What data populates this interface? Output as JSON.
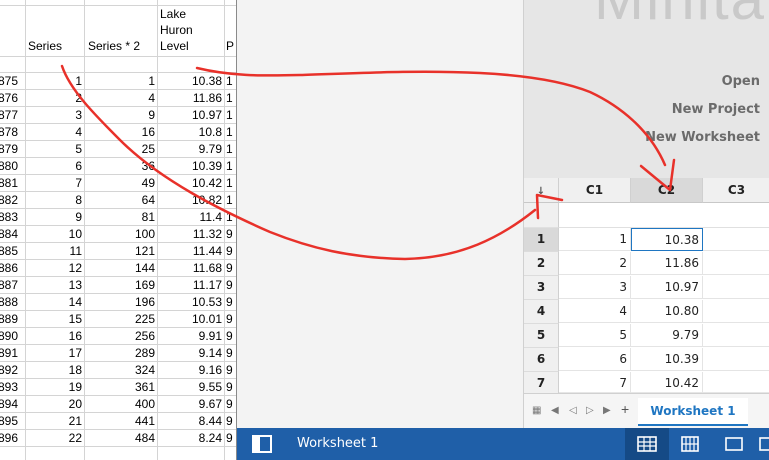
{
  "excel": {
    "headers": {
      "series": "Series",
      "series_sq": "Series * 2",
      "lake_line1": "Lake",
      "lake_line2": "Huron",
      "lake_line3": "Level",
      "partial": "P"
    },
    "rows": [
      {
        "year": "875",
        "s": "1",
        "sq": "1",
        "lv": "10.38",
        "p": "1"
      },
      {
        "year": "876",
        "s": "2",
        "sq": "4",
        "lv": "11.86",
        "p": "1"
      },
      {
        "year": "877",
        "s": "3",
        "sq": "9",
        "lv": "10.97",
        "p": "1"
      },
      {
        "year": "878",
        "s": "4",
        "sq": "16",
        "lv": "10.8",
        "p": "1"
      },
      {
        "year": "879",
        "s": "5",
        "sq": "25",
        "lv": "9.79",
        "p": "1"
      },
      {
        "year": "880",
        "s": "6",
        "sq": "36",
        "lv": "10.39",
        "p": "1"
      },
      {
        "year": "881",
        "s": "7",
        "sq": "49",
        "lv": "10.42",
        "p": "1"
      },
      {
        "year": "882",
        "s": "8",
        "sq": "64",
        "lv": "10.82",
        "p": "1"
      },
      {
        "year": "883",
        "s": "9",
        "sq": "81",
        "lv": "11.4",
        "p": "1"
      },
      {
        "year": "884",
        "s": "10",
        "sq": "100",
        "lv": "11.32",
        "p": "9"
      },
      {
        "year": "885",
        "s": "11",
        "sq": "121",
        "lv": "11.44",
        "p": "9"
      },
      {
        "year": "886",
        "s": "12",
        "sq": "144",
        "lv": "11.68",
        "p": "9"
      },
      {
        "year": "887",
        "s": "13",
        "sq": "169",
        "lv": "11.17",
        "p": "9"
      },
      {
        "year": "888",
        "s": "14",
        "sq": "196",
        "lv": "10.53",
        "p": "9"
      },
      {
        "year": "889",
        "s": "15",
        "sq": "225",
        "lv": "10.01",
        "p": "9"
      },
      {
        "year": "890",
        "s": "16",
        "sq": "256",
        "lv": "9.91",
        "p": "9"
      },
      {
        "year": "891",
        "s": "17",
        "sq": "289",
        "lv": "9.14",
        "p": "9"
      },
      {
        "year": "892",
        "s": "18",
        "sq": "324",
        "lv": "9.16",
        "p": "9"
      },
      {
        "year": "893",
        "s": "19",
        "sq": "361",
        "lv": "9.55",
        "p": "9"
      },
      {
        "year": "894",
        "s": "20",
        "sq": "400",
        "lv": "9.67",
        "p": "9"
      },
      {
        "year": "895",
        "s": "21",
        "sq": "441",
        "lv": "8.44",
        "p": "9"
      },
      {
        "year": "896",
        "s": "22",
        "sq": "484",
        "lv": "8.24",
        "p": "9"
      }
    ]
  },
  "minitab": {
    "logo": "Minita",
    "links": {
      "open": "Open",
      "new_project": "New Project",
      "new_worksheet": "New Worksheet"
    },
    "worksheet": {
      "columns": [
        "C1",
        "C2",
        "C3"
      ],
      "rows": [
        {
          "n": "1",
          "c1": "1",
          "c2": "10.38"
        },
        {
          "n": "2",
          "c1": "2",
          "c2": "11.86"
        },
        {
          "n": "3",
          "c1": "3",
          "c2": "10.97"
        },
        {
          "n": "4",
          "c1": "4",
          "c2": "10.80"
        },
        {
          "n": "5",
          "c1": "5",
          "c2": "9.79"
        },
        {
          "n": "6",
          "c1": "6",
          "c2": "10.39"
        },
        {
          "n": "7",
          "c1": "7",
          "c2": "10.42"
        }
      ]
    },
    "tab_label": "Worksheet 1",
    "status_label": "Worksheet 1"
  },
  "colors": {
    "annotation": "#e8312a",
    "status_bar": "#1f5fa8",
    "selection": "#1f76c2"
  }
}
